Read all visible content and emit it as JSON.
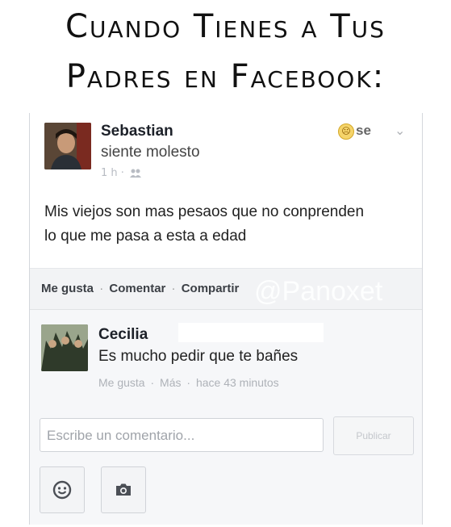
{
  "meme": {
    "line1": "Cuando Tienes a Tus",
    "line2": "Padres en Facebook:"
  },
  "post": {
    "author": "Sebastian",
    "feeling": "siente molesto",
    "meta": "1 h ·",
    "feeling_tag": "se",
    "text_line1": "Mis viejos son mas pesaos que no conprenden",
    "text_line2": "lo que me pasa a esta a edad"
  },
  "actions": {
    "like": "Me gusta",
    "comment": "Comentar",
    "share": "Compartir",
    "separator": "·"
  },
  "watermark": "@Panoxet",
  "comment": {
    "author": "Cecilia",
    "text": "Es mucho pedir que te bañes",
    "like": "Me gusta",
    "more": "Más",
    "time": "hace 43 minutos"
  },
  "composer": {
    "placeholder": "Escribe un comentario...",
    "publish": "Publicar"
  },
  "icons": {
    "emoji": "smiley-icon",
    "camera": "camera-icon",
    "privacy": "friends-icon",
    "options": "chevron-down-icon"
  },
  "colors": {
    "name_text": "#1d2129",
    "meta_text": "#aeb2b8",
    "bar_bg": "#f2f3f5"
  }
}
